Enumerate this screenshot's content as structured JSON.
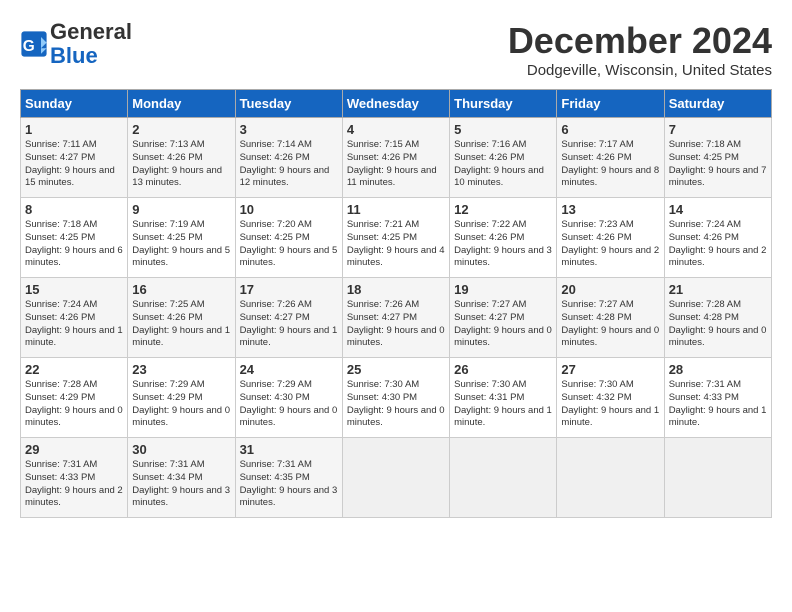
{
  "header": {
    "logo_general": "General",
    "logo_blue": "Blue",
    "month_title": "December 2024",
    "location": "Dodgeville, Wisconsin, United States"
  },
  "weekdays": [
    "Sunday",
    "Monday",
    "Tuesday",
    "Wednesday",
    "Thursday",
    "Friday",
    "Saturday"
  ],
  "weeks": [
    [
      {
        "day": "1",
        "sunrise": "7:11 AM",
        "sunset": "4:27 PM",
        "daylight": "9 hours and 15 minutes."
      },
      {
        "day": "2",
        "sunrise": "7:13 AM",
        "sunset": "4:26 PM",
        "daylight": "9 hours and 13 minutes."
      },
      {
        "day": "3",
        "sunrise": "7:14 AM",
        "sunset": "4:26 PM",
        "daylight": "9 hours and 12 minutes."
      },
      {
        "day": "4",
        "sunrise": "7:15 AM",
        "sunset": "4:26 PM",
        "daylight": "9 hours and 11 minutes."
      },
      {
        "day": "5",
        "sunrise": "7:16 AM",
        "sunset": "4:26 PM",
        "daylight": "9 hours and 10 minutes."
      },
      {
        "day": "6",
        "sunrise": "7:17 AM",
        "sunset": "4:26 PM",
        "daylight": "9 hours and 8 minutes."
      },
      {
        "day": "7",
        "sunrise": "7:18 AM",
        "sunset": "4:25 PM",
        "daylight": "9 hours and 7 minutes."
      }
    ],
    [
      {
        "day": "8",
        "sunrise": "7:18 AM",
        "sunset": "4:25 PM",
        "daylight": "9 hours and 6 minutes."
      },
      {
        "day": "9",
        "sunrise": "7:19 AM",
        "sunset": "4:25 PM",
        "daylight": "9 hours and 5 minutes."
      },
      {
        "day": "10",
        "sunrise": "7:20 AM",
        "sunset": "4:25 PM",
        "daylight": "9 hours and 5 minutes."
      },
      {
        "day": "11",
        "sunrise": "7:21 AM",
        "sunset": "4:25 PM",
        "daylight": "9 hours and 4 minutes."
      },
      {
        "day": "12",
        "sunrise": "7:22 AM",
        "sunset": "4:26 PM",
        "daylight": "9 hours and 3 minutes."
      },
      {
        "day": "13",
        "sunrise": "7:23 AM",
        "sunset": "4:26 PM",
        "daylight": "9 hours and 2 minutes."
      },
      {
        "day": "14",
        "sunrise": "7:24 AM",
        "sunset": "4:26 PM",
        "daylight": "9 hours and 2 minutes."
      }
    ],
    [
      {
        "day": "15",
        "sunrise": "7:24 AM",
        "sunset": "4:26 PM",
        "daylight": "9 hours and 1 minute."
      },
      {
        "day": "16",
        "sunrise": "7:25 AM",
        "sunset": "4:26 PM",
        "daylight": "9 hours and 1 minute."
      },
      {
        "day": "17",
        "sunrise": "7:26 AM",
        "sunset": "4:27 PM",
        "daylight": "9 hours and 1 minute."
      },
      {
        "day": "18",
        "sunrise": "7:26 AM",
        "sunset": "4:27 PM",
        "daylight": "9 hours and 0 minutes."
      },
      {
        "day": "19",
        "sunrise": "7:27 AM",
        "sunset": "4:27 PM",
        "daylight": "9 hours and 0 minutes."
      },
      {
        "day": "20",
        "sunrise": "7:27 AM",
        "sunset": "4:28 PM",
        "daylight": "9 hours and 0 minutes."
      },
      {
        "day": "21",
        "sunrise": "7:28 AM",
        "sunset": "4:28 PM",
        "daylight": "9 hours and 0 minutes."
      }
    ],
    [
      {
        "day": "22",
        "sunrise": "7:28 AM",
        "sunset": "4:29 PM",
        "daylight": "9 hours and 0 minutes."
      },
      {
        "day": "23",
        "sunrise": "7:29 AM",
        "sunset": "4:29 PM",
        "daylight": "9 hours and 0 minutes."
      },
      {
        "day": "24",
        "sunrise": "7:29 AM",
        "sunset": "4:30 PM",
        "daylight": "9 hours and 0 minutes."
      },
      {
        "day": "25",
        "sunrise": "7:30 AM",
        "sunset": "4:30 PM",
        "daylight": "9 hours and 0 minutes."
      },
      {
        "day": "26",
        "sunrise": "7:30 AM",
        "sunset": "4:31 PM",
        "daylight": "9 hours and 1 minute."
      },
      {
        "day": "27",
        "sunrise": "7:30 AM",
        "sunset": "4:32 PM",
        "daylight": "9 hours and 1 minute."
      },
      {
        "day": "28",
        "sunrise": "7:31 AM",
        "sunset": "4:33 PM",
        "daylight": "9 hours and 1 minute."
      }
    ],
    [
      {
        "day": "29",
        "sunrise": "7:31 AM",
        "sunset": "4:33 PM",
        "daylight": "9 hours and 2 minutes."
      },
      {
        "day": "30",
        "sunrise": "7:31 AM",
        "sunset": "4:34 PM",
        "daylight": "9 hours and 3 minutes."
      },
      {
        "day": "31",
        "sunrise": "7:31 AM",
        "sunset": "4:35 PM",
        "daylight": "9 hours and 3 minutes."
      },
      null,
      null,
      null,
      null
    ]
  ]
}
